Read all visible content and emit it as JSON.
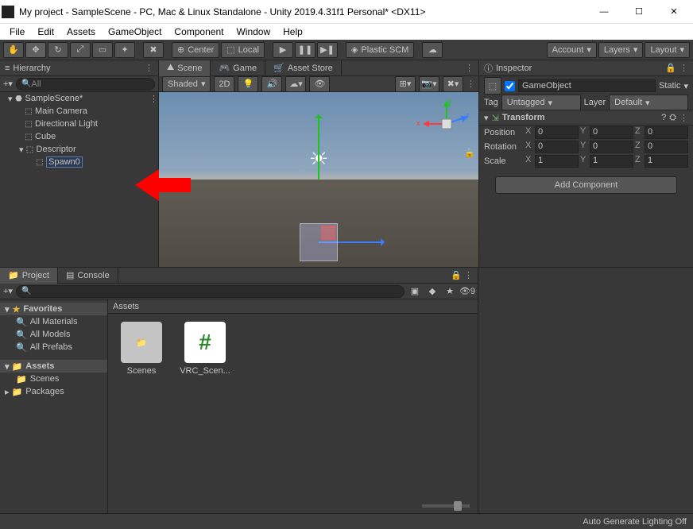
{
  "window": {
    "title": "My project - SampleScene - PC, Mac & Linux Standalone - Unity 2019.4.31f1 Personal* <DX11>"
  },
  "menu": [
    "File",
    "Edit",
    "Assets",
    "GameObject",
    "Component",
    "Window",
    "Help"
  ],
  "toolbar": {
    "pivot": "Center",
    "space": "Local",
    "vcs": "Plastic SCM",
    "account": "Account",
    "layers": "Layers",
    "layout": "Layout"
  },
  "hierarchy": {
    "title": "Hierarchy",
    "search_ph": "All",
    "scene": "SampleScene*",
    "items": [
      "Main Camera",
      "Directional Light",
      "Cube",
      "Descriptor"
    ],
    "editing": "Spawn0"
  },
  "scene_tabs": {
    "scene": "Scene",
    "game": "Game",
    "store": "Asset Store",
    "shaded": "Shaded",
    "mode": "2D",
    "axes": {
      "x": "x",
      "y": "y",
      "z": "z"
    }
  },
  "inspector": {
    "title": "Inspector",
    "name": "GameObject",
    "static": "Static",
    "tag_label": "Tag",
    "tag": "Untagged",
    "layer_label": "Layer",
    "layer": "Default",
    "transform": "Transform",
    "pos": "Position",
    "rot": "Rotation",
    "scl": "Scale",
    "px": "0",
    "py": "0",
    "pz": "0",
    "rx": "0",
    "ry": "0",
    "rz": "0",
    "sx": "1",
    "sy": "1",
    "sz": "1",
    "add": "Add Component"
  },
  "project": {
    "tab_project": "Project",
    "tab_console": "Console",
    "favorites": "Favorites",
    "fav_items": [
      "All Materials",
      "All Models",
      "All Prefabs"
    ],
    "assets": "Assets",
    "asset_items": [
      "Scenes"
    ],
    "packages": "Packages",
    "crumb": "Assets",
    "items": [
      {
        "name": "Scenes",
        "type": "folder"
      },
      {
        "name": "VRC_Scen...",
        "type": "file"
      }
    ],
    "hidden_count": "9"
  },
  "status": "Auto Generate Lighting Off"
}
